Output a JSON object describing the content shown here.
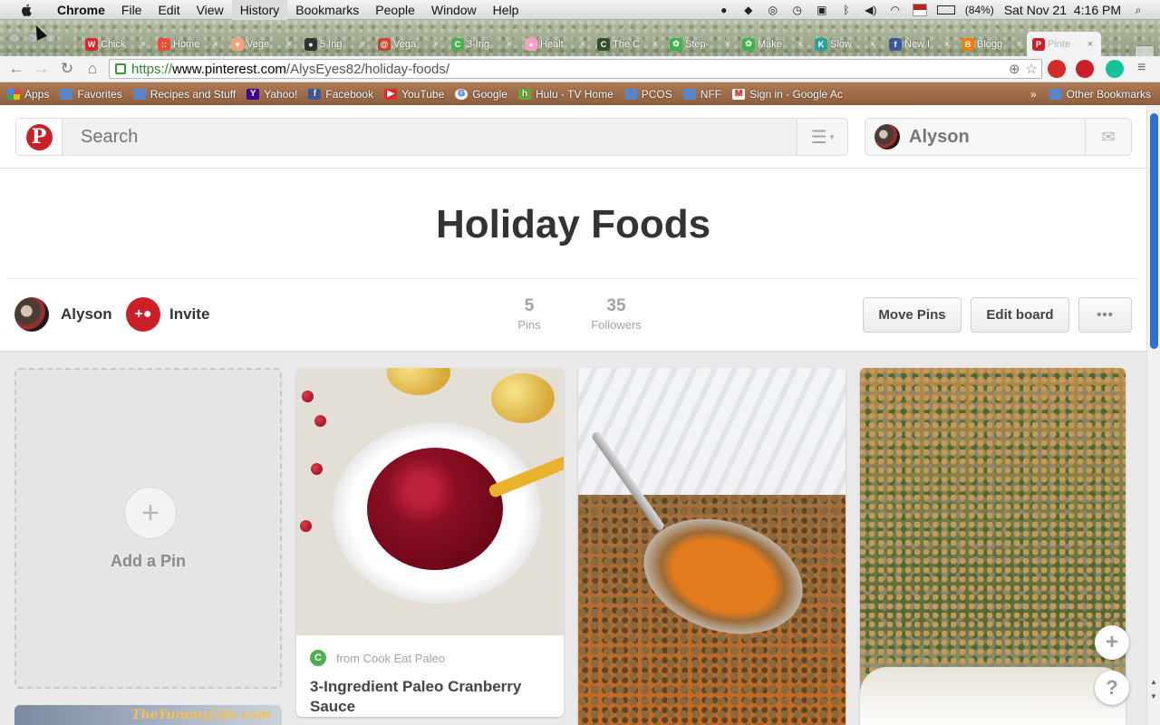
{
  "menubar": {
    "app": "Chrome",
    "items": [
      "File",
      "Edit",
      "View",
      "History",
      "Bookmarks",
      "People",
      "Window",
      "Help"
    ],
    "battery": "(84%)",
    "datetime": "Sat Nov 21  4:16 PM"
  },
  "tabs": [
    {
      "title": "Chick",
      "color": "#d7262d",
      "glyph": "W"
    },
    {
      "title": "Home",
      "color": "#e94f37",
      "glyph": "::"
    },
    {
      "title": "Vege",
      "color": "#f7a07a",
      "glyph": "♥"
    },
    {
      "title": "5 Ing",
      "color": "#333333",
      "glyph": "●"
    },
    {
      "title": "Vega",
      "color": "#c9482b",
      "glyph": "@"
    },
    {
      "title": "3-Ing",
      "color": "#4caf50",
      "glyph": "C"
    },
    {
      "title": "Healt",
      "color": "#f4a0c0",
      "glyph": "●"
    },
    {
      "title": "The C",
      "color": "#2d4f2d",
      "glyph": "C"
    },
    {
      "title": "Step-",
      "color": "#3cb44b",
      "glyph": "✿"
    },
    {
      "title": "Make",
      "color": "#3cb44b",
      "glyph": "✿"
    },
    {
      "title": "Slow",
      "color": "#2aa198",
      "glyph": "K"
    },
    {
      "title": "New I",
      "color": "#3b5998",
      "glyph": "f"
    },
    {
      "title": "Blogg",
      "color": "#f57d00",
      "glyph": "B"
    },
    {
      "title": "Pinte",
      "color": "#cb2027",
      "glyph": "P",
      "active": true
    }
  ],
  "address_bar": {
    "scheme": "https://",
    "host": "www.pinterest.com",
    "path": "/AlysEyes82/holiday-foods/"
  },
  "bookmarks": [
    {
      "label": "Apps",
      "icon": "apps-icon"
    },
    {
      "label": "Favorites",
      "icon": "folder-icon"
    },
    {
      "label": "Recipes and Stuff",
      "icon": "folder-icon"
    },
    {
      "label": "Yahoo!",
      "icon": "yahoo-icon"
    },
    {
      "label": "Facebook",
      "icon": "facebook-icon"
    },
    {
      "label": "YouTube",
      "icon": "youtube-icon"
    },
    {
      "label": "Google",
      "icon": "google-icon"
    },
    {
      "label": "Hulu - TV Home",
      "icon": "hulu-icon"
    },
    {
      "label": "PCOS",
      "icon": "folder-icon"
    },
    {
      "label": "NFF",
      "icon": "folder-icon"
    },
    {
      "label": "Sign in - Google Ac",
      "icon": "gmail-icon"
    }
  ],
  "bookmarks_overflow": "»",
  "other_bookmarks": "Other Bookmarks",
  "header": {
    "search_placeholder": "Search",
    "user_name": "Alyson"
  },
  "board": {
    "title": "Holiday Foods",
    "owner": "Alyson",
    "invite_label": "Invite",
    "pins_count": "5",
    "pins_label": "Pins",
    "followers_count": "35",
    "followers_label": "Followers",
    "move_pins_label": "Move Pins",
    "edit_board_label": "Edit board",
    "more_label": "•••"
  },
  "add_pin_label": "Add a Pin",
  "pins": [
    {
      "source": "from Cook Eat Paleo",
      "description": "3-Ingredient Paleo Cranberry Sauce"
    }
  ],
  "below_card_text": "TheYummyLife.com",
  "colors": {
    "pinterest_red": "#cb2027",
    "board_bg": "#e9e9e9"
  }
}
